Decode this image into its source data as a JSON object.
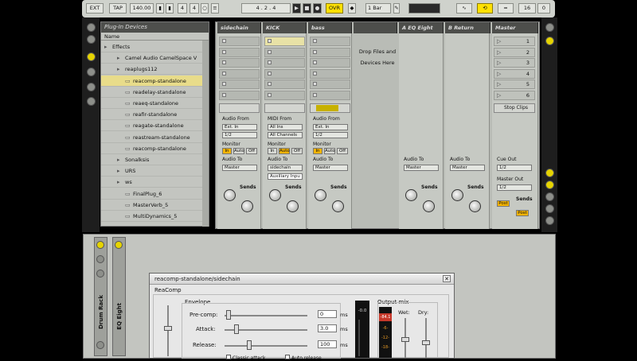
{
  "transport": {
    "ext": "EXT",
    "tap": "TAP",
    "tempo": "140.00",
    "sig_num": "4",
    "sig_den": "4",
    "position": "4 . 2 . 4",
    "ovr": "OVR",
    "quant": "1 Bar",
    "bars": "16",
    "bars2": "0"
  },
  "browser": {
    "title": "Plug-In Devices",
    "col_header": "Name",
    "items": [
      {
        "label": "Effects",
        "kind": "folder"
      },
      {
        "label": "Camel Audio CamelSpace V",
        "kind": "folder"
      },
      {
        "label": "reaplugs112",
        "kind": "folder"
      },
      {
        "label": "reacomp-standalone",
        "kind": "plugin",
        "selected": true
      },
      {
        "label": "readelay-standalone",
        "kind": "plugin"
      },
      {
        "label": "reaeq-standalone",
        "kind": "plugin"
      },
      {
        "label": "reafir-standalone",
        "kind": "plugin"
      },
      {
        "label": "reagate-standalone",
        "kind": "plugin"
      },
      {
        "label": "reastream-standalone",
        "kind": "plugin"
      },
      {
        "label": "reacomp-standalone",
        "kind": "plugin"
      },
      {
        "label": "Sonalksis",
        "kind": "folder"
      },
      {
        "label": "URS",
        "kind": "folder"
      },
      {
        "label": "ws",
        "kind": "folder"
      },
      {
        "label": "FinalPlug_6",
        "kind": "plugin"
      },
      {
        "label": "MasterVerb_5",
        "kind": "plugin"
      },
      {
        "label": "MultiDynamics_5",
        "kind": "plugin"
      }
    ]
  },
  "session": {
    "tracks": [
      {
        "name": "sidechain",
        "input_type": "Audio From",
        "input_src": "Ext. In",
        "input_ch": "1/2",
        "out_label": "Audio To",
        "out": "Master"
      },
      {
        "name": "KICK",
        "input_type": "MIDI From",
        "input_src": "All Ins",
        "input_ch": "All Channels",
        "out_label": "Audio To",
        "out": "sidechain",
        "out2": "Auxiliary Inpu"
      },
      {
        "name": "bass",
        "input_type": "Audio From",
        "input_src": "Ext. In",
        "input_ch": "1/2",
        "out_label": "Audio To",
        "out": "Master"
      }
    ],
    "drop_text": "Drop Files and Devices Here",
    "returns": [
      {
        "name": "A EQ Eight",
        "out_label": "Audio To",
        "out": "Master"
      },
      {
        "name": "B Return",
        "out_label": "Audio To",
        "out": "Master"
      }
    ],
    "master": {
      "name": "Master",
      "scenes": [
        "1",
        "2",
        "3",
        "4",
        "5",
        "6"
      ],
      "stop_clips": "Stop Clips",
      "cue_out": "Cue Out",
      "cue_val": "1/2",
      "master_out": "Master Out",
      "master_val": "1/2",
      "post": "Post"
    },
    "monitor_label": "Monitor",
    "monitor_opts": [
      "In",
      "Auto",
      "Off"
    ],
    "sends_label": "Sends"
  },
  "device_strip": {
    "drum_rack": "Drum Rack",
    "eq_eight": "EQ Eight"
  },
  "reacomp": {
    "title": "reacomp-standalone/sidechain",
    "group": "ReaComp",
    "envelope": "Envelope",
    "precomp_label": "Pre-comp:",
    "precomp_val": "0",
    "attack_label": "Attack:",
    "attack_val": "3.0",
    "release_label": "Release:",
    "release_val": "100",
    "unit": "ms",
    "meter_top": "-0.0",
    "output_mix": "Output mix",
    "wet": "Wet:",
    "dry": "Dry:",
    "wet_meter": "-84.1",
    "meter_ticks": [
      "-6-",
      "-12-",
      "-18-"
    ],
    "classic_attack": "Classic attack",
    "auto_release": "Auto release"
  }
}
